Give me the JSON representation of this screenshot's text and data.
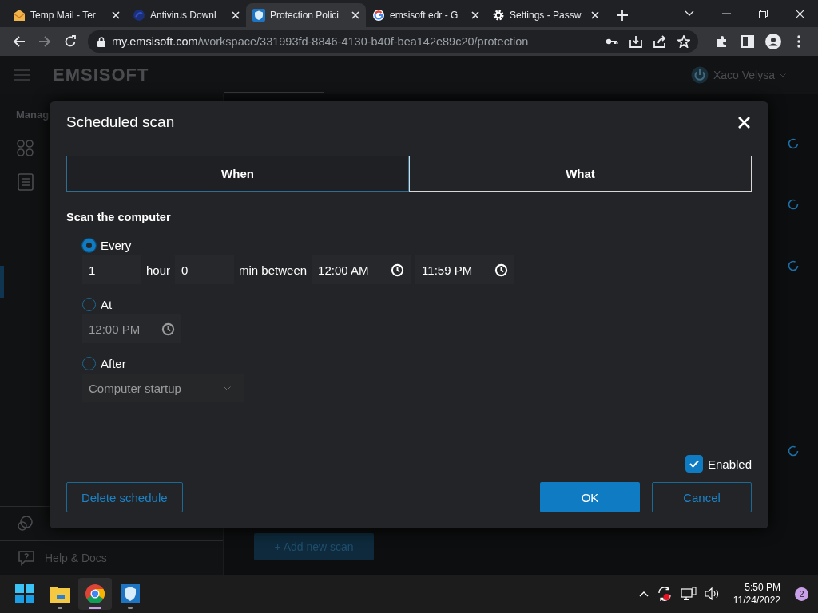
{
  "browser": {
    "tabs": [
      {
        "title": "Temp Mail - Ter",
        "selected": false
      },
      {
        "title": "Antivirus Downl",
        "selected": false
      },
      {
        "title": "Protection Polici",
        "selected": true
      },
      {
        "title": "emsisoft edr - G",
        "selected": false
      },
      {
        "title": "Settings - Passw",
        "selected": false
      }
    ],
    "url": {
      "host": "my.emsisoft.com",
      "path": "/workspace/331993fd-8846-4130-b40f-bea142e89c20/protection"
    }
  },
  "app": {
    "logo": "EMSISOFT",
    "user": "Xaco Velysa",
    "section_heading": "Manag",
    "footer": "Help & Docs",
    "add_button": "+ Add new scan"
  },
  "dialog": {
    "title": "Scheduled scan",
    "tabs": [
      {
        "label": "When",
        "selected": true
      },
      {
        "label": "What",
        "selected": false
      }
    ],
    "section": "Scan the computer",
    "options": [
      {
        "label": "Every",
        "selected": true,
        "controls": [
          {
            "kind": "input",
            "value": "1"
          },
          {
            "kind": "label",
            "text": "hour"
          },
          {
            "kind": "input",
            "value": "0"
          },
          {
            "kind": "label",
            "text": "min between"
          },
          {
            "kind": "time",
            "value": "12:00 AM"
          },
          {
            "kind": "time",
            "value": "11:59 PM"
          }
        ]
      },
      {
        "label": "At",
        "selected": false,
        "controls": [
          {
            "kind": "time",
            "value": "12:00 PM"
          }
        ]
      },
      {
        "label": "After",
        "selected": false,
        "controls": [
          {
            "kind": "select",
            "value": "Computer startup"
          }
        ]
      }
    ],
    "enabled": {
      "label": "Enabled",
      "checked": true
    },
    "buttons": [
      {
        "label": "Delete schedule",
        "kind": "outline"
      },
      {
        "label": "OK",
        "kind": "primary"
      },
      {
        "label": "Cancel",
        "kind": "outline"
      }
    ]
  },
  "taskbar": {
    "apps": [
      {
        "running": false,
        "selected": false
      },
      {
        "running": true,
        "selected": false
      },
      {
        "running": true,
        "selected": true
      },
      {
        "running": true,
        "selected": false
      }
    ],
    "time": "5:50 PM",
    "date": "11/24/2022",
    "notifications": "2"
  }
}
